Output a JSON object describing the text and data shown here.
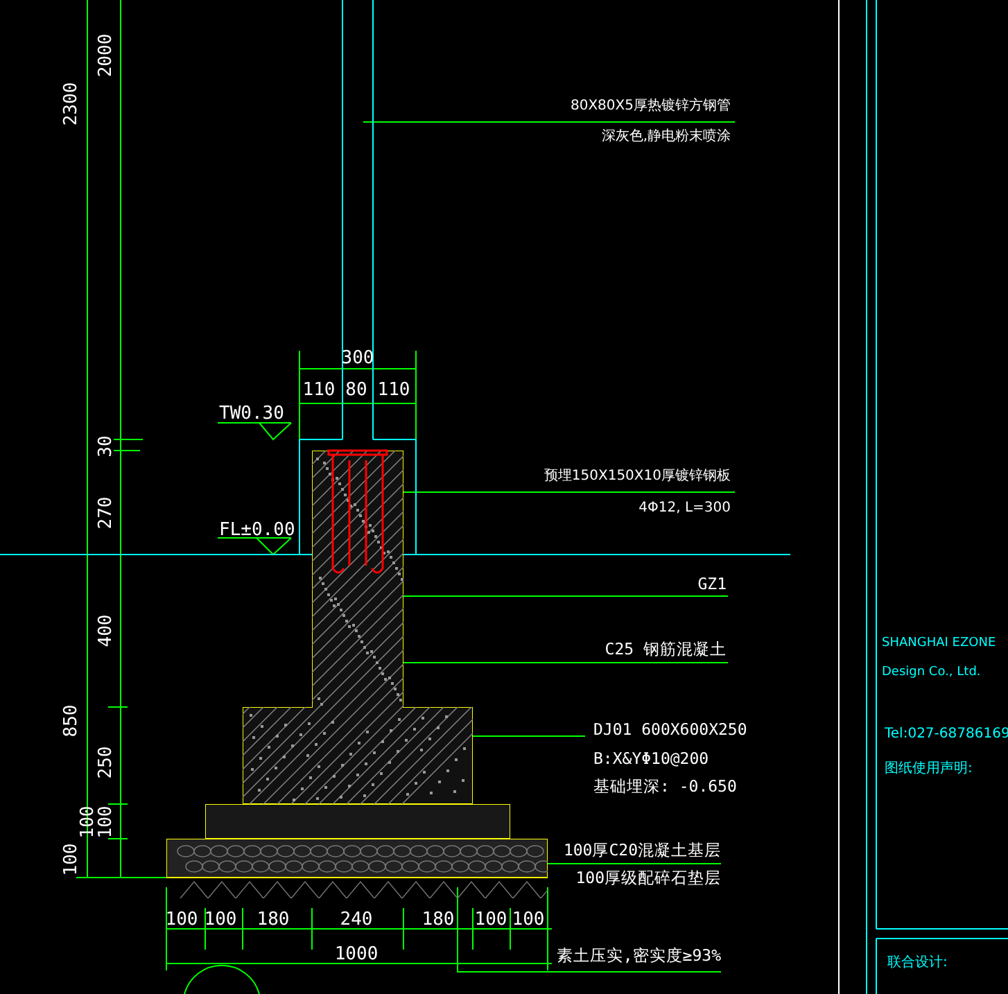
{
  "vertical_dimensions": [
    "2300",
    "2000",
    "30",
    "270",
    "400",
    "850",
    "250",
    "100",
    "100",
    "100"
  ],
  "top_dimensions": [
    "300",
    "110",
    "80",
    "110"
  ],
  "bottom_dimensions": [
    "100",
    "100",
    "180",
    "240",
    "180",
    "100",
    "100"
  ],
  "total_dimension": "1000",
  "levels": [
    "TW0.30",
    "FL±0.00"
  ],
  "callouts": [
    "80X80X5厚热镀锌方钢管",
    "深灰色,静电粉末喷涂",
    "预埋150X150X10厚镀锌钢板",
    "4Φ12, L=300",
    "GZ1",
    "C25 钢筋混凝土",
    "DJ01  600X600X250",
    "B:X&YΦ10@200",
    "基础埋深: -0.650",
    "100厚C20混凝土基层",
    "100厚级配碎石垫层",
    "素土压实,密实度≥93%"
  ],
  "title_block": {
    "company": [
      "SHANGHAI EZONE",
      "Design Co., Ltd."
    ],
    "phone": "Tel:027-68786169",
    "notice_heading": "图纸使用声明:",
    "joint_design": "联合设计:"
  }
}
